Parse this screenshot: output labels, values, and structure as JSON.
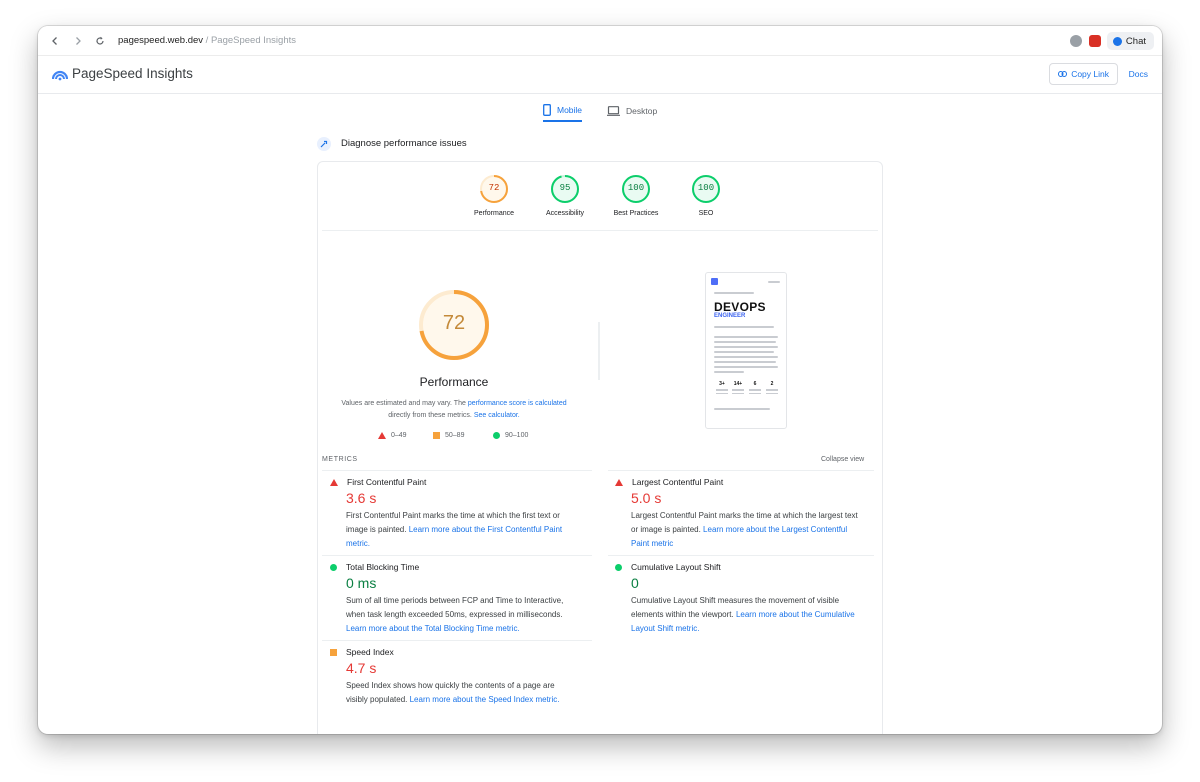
{
  "browser": {
    "url_host": "pagespeed.web.dev",
    "url_path": " / PageSpeed Insights",
    "chat_label": "Chat"
  },
  "header": {
    "title": "PageSpeed Insights",
    "copy_link": "Copy Link",
    "docs": "Docs"
  },
  "tabs": [
    {
      "label": "Mobile",
      "active": true
    },
    {
      "label": "Desktop",
      "active": false
    }
  ],
  "diagnose_title": "Diagnose performance issues",
  "scores": [
    {
      "label": "Performance",
      "value": "72",
      "color": "#f6a23c"
    },
    {
      "label": "Accessibility",
      "value": "95",
      "color": "#0cce6b"
    },
    {
      "label": "Best Practices",
      "value": "100",
      "color": "#0cce6b"
    },
    {
      "label": "SEO",
      "value": "100",
      "color": "#0cce6b"
    }
  ],
  "performance": {
    "score": "72",
    "title": "Performance",
    "note_prefix": "Values are estimated and may vary. The ",
    "note_link1": "performance score is calculated",
    "note_mid": " directly from these metrics. ",
    "note_link2": "See calculator.",
    "legend": [
      "0–49",
      "50–89",
      "90–100"
    ]
  },
  "screenshot_preview": {
    "heading": "DEVOPS",
    "subheading": "ENGINEER",
    "stats": [
      "3+",
      "14+",
      "6",
      "2"
    ]
  },
  "metrics_label": "METRICS",
  "collapse_label": "Collapse view",
  "metrics": [
    {
      "name": "First Contentful Paint",
      "value": "3.6 s",
      "status": "fail",
      "desc": "First Contentful Paint marks the time at which the first text or image is painted. ",
      "link": "Learn more about the First Contentful Paint metric."
    },
    {
      "name": "Largest Contentful Paint",
      "value": "5.0 s",
      "status": "fail",
      "desc": "Largest Contentful Paint marks the time at which the largest text or image is painted. ",
      "link": "Learn more about the Largest Contentful Paint metric"
    },
    {
      "name": "Total Blocking Time",
      "value": "0 ms",
      "status": "pass",
      "desc": "Sum of all time periods between FCP and Time to Interactive, when task length exceeded 50ms, expressed in milliseconds. ",
      "link": "Learn more about the Total Blocking Time metric."
    },
    {
      "name": "Cumulative Layout Shift",
      "value": "0",
      "status": "pass",
      "desc": "Cumulative Layout Shift measures the movement of visible elements within the viewport. ",
      "link": "Learn more about the Cumulative Layout Shift metric."
    },
    {
      "name": "Speed Index",
      "value": "4.7 s",
      "status": "average",
      "desc": "Speed Index shows how quickly the contents of a page are visibly populated. ",
      "link": "Learn more about the Speed Index metric."
    }
  ]
}
